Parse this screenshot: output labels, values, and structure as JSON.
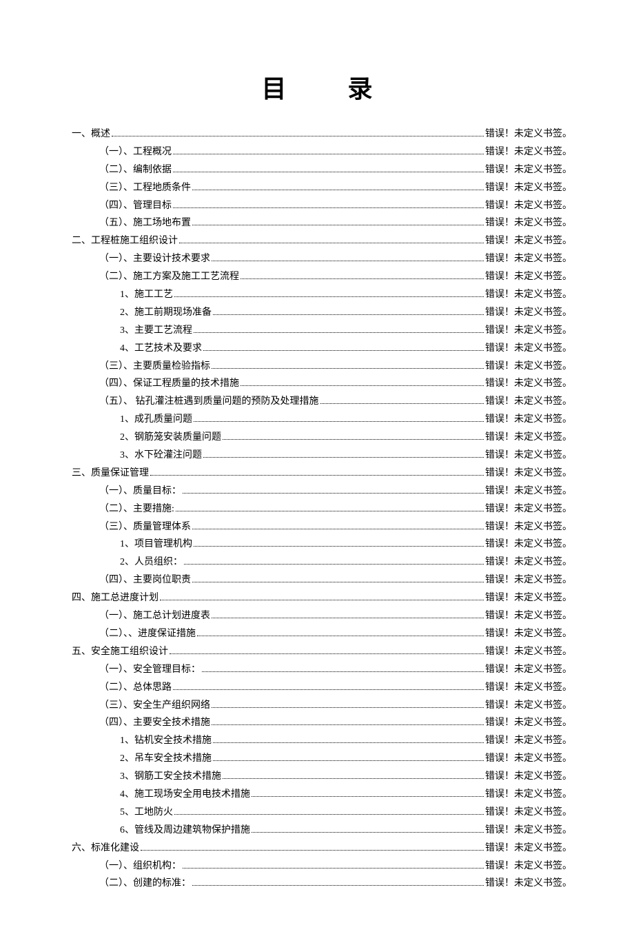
{
  "title": "目 录",
  "defaultPage": "错误！未定义书签。",
  "entries": [
    {
      "level": 0,
      "text": "一、概述"
    },
    {
      "level": 1,
      "text": "（一）、工程概况"
    },
    {
      "level": 1,
      "text": "（二）、编制依据"
    },
    {
      "level": 1,
      "text": "（三）、工程地质条件"
    },
    {
      "level": 1,
      "text": "（四）、管理目标"
    },
    {
      "level": 1,
      "text": "（五）、施工场地布置"
    },
    {
      "level": 0,
      "text": "二、工程桩施工组织设计"
    },
    {
      "level": 1,
      "text": "（一）、主要设计技术要求"
    },
    {
      "level": 1,
      "text": "（二）、施工方案及施工工艺流程"
    },
    {
      "level": 2,
      "text": "1、施工工艺"
    },
    {
      "level": 2,
      "text": "2、施工前期现场准备"
    },
    {
      "level": 2,
      "text": "3、主要工艺流程"
    },
    {
      "level": 2,
      "text": "4、工艺技术及要求"
    },
    {
      "level": 1,
      "text": "（三）、主要质量检验指标"
    },
    {
      "level": 1,
      "text": "（四）、保证工程质量的技术措施"
    },
    {
      "level": 1,
      "text": "（五）、 钻孔灌注桩遇到质量问题的预防及处理措施"
    },
    {
      "level": 2,
      "text": "1、成孔质量问题"
    },
    {
      "level": 2,
      "text": "2、钢筋笼安装质量问题"
    },
    {
      "level": 2,
      "text": "3、水下砼灌注问题"
    },
    {
      "level": 0,
      "text": "三、质量保证管理"
    },
    {
      "level": 1,
      "text": "（一）、质量目标："
    },
    {
      "level": 1,
      "text": "（二）、主要措施:"
    },
    {
      "level": 1,
      "text": "（三）、质量管理体系"
    },
    {
      "level": 2,
      "text": "1、项目管理机构"
    },
    {
      "level": 2,
      "text": "2、人员组织："
    },
    {
      "level": 1,
      "text": "（四）、主要岗位职责"
    },
    {
      "level": 0,
      "text": "四、施工总进度计划"
    },
    {
      "level": 1,
      "text": "（一）、施工总计划进度表"
    },
    {
      "level": 1,
      "text": "（二）、、进度保证措施"
    },
    {
      "level": 0,
      "text": "五、安全施工组织设计"
    },
    {
      "level": 1,
      "text": "（一）、安全管理目标："
    },
    {
      "level": 1,
      "text": "（二）、总体思路"
    },
    {
      "level": 1,
      "text": "（三）、安全生产组织网络"
    },
    {
      "level": 1,
      "text": "（四）、主要安全技术措施"
    },
    {
      "level": 2,
      "text": "1、钻机安全技术措施"
    },
    {
      "level": 2,
      "text": "2、吊车安全技术措施"
    },
    {
      "level": 2,
      "text": "3、钢筋工安全技术措施"
    },
    {
      "level": 2,
      "text": "4、施工现场安全用电技术措施"
    },
    {
      "level": 2,
      "text": "5、工地防火"
    },
    {
      "level": 2,
      "text": "6、管线及周边建筑物保护措施"
    },
    {
      "level": 0,
      "text": "六、标准化建设"
    },
    {
      "level": 1,
      "text": "（一）、组织机构："
    },
    {
      "level": 1,
      "text": "（二）、创建的标准："
    }
  ]
}
